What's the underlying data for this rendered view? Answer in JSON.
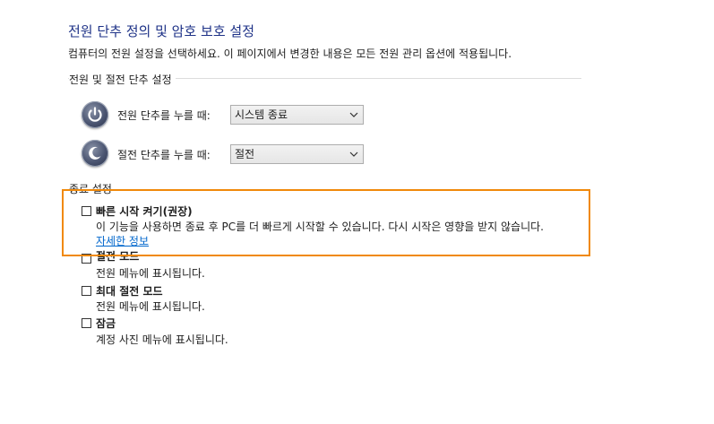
{
  "header": {
    "title": "전원 단추 정의 및 암호 보호 설정",
    "subtitle": "컴퓨터의 전원 설정을 선택하세요. 이 페이지에서 변경한 내용은 모든 전원 관리 옵션에 적용됩니다."
  },
  "power_section": {
    "label": "전원 및 절전 단추 설정",
    "rows": [
      {
        "label": "전원 단추를 누를 때:",
        "value": "시스템 종료",
        "icon": "power-button-icon"
      },
      {
        "label": "절전 단추를 누를 때:",
        "value": "절전",
        "icon": "sleep-button-icon"
      }
    ]
  },
  "shutdown_section": {
    "label": "종료 설정",
    "fast_startup": {
      "title": "빠른 시작 켜기(권장)",
      "description": "이 기능을 사용하면 종료 후 PC를 더 빠르게 시작할 수 있습니다. 다시 시작은 영향을 받지 않습니다.",
      "link": "자세한 정보",
      "checked": false
    },
    "options": [
      {
        "title": "절전 모드",
        "description": "전원 메뉴에 표시됩니다.",
        "checked": false
      },
      {
        "title": "최대 절전 모드",
        "description": "전원 메뉴에 표시됩니다.",
        "checked": false
      },
      {
        "title": "잠금",
        "description": "계정 사진 메뉴에 표시됩니다.",
        "checked": false
      }
    ]
  },
  "colors": {
    "title": "#1e3287",
    "link": "#0066cc",
    "highlight": "#f0890a"
  }
}
